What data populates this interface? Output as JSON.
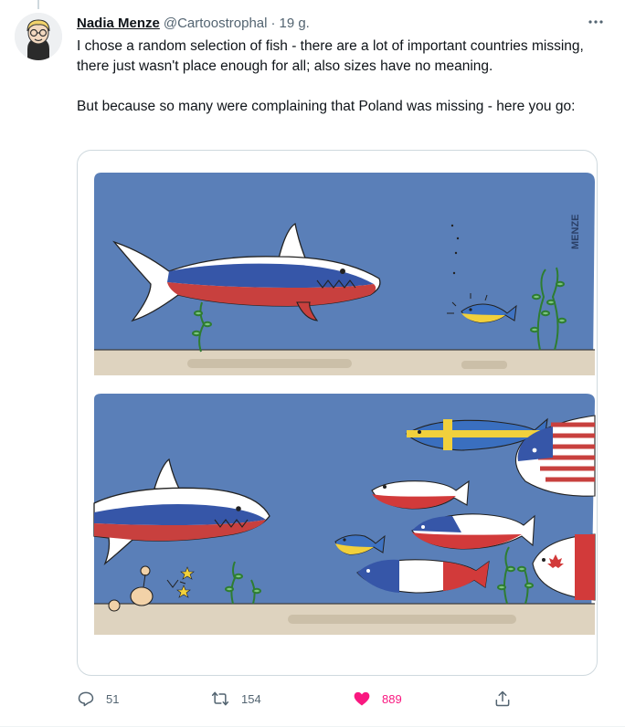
{
  "tweet": {
    "author_name": "Nadia Menze",
    "handle": "@Cartoostrophal",
    "separator": "·",
    "time": "19 g.",
    "paragraphs": [
      "I chose a random selection of fish - there are a lot of important countries missing, there just wasn't place enough for all; also sizes have no meaning.",
      "But because so many were complaining that Poland was missing - here you go:"
    ],
    "media": {
      "signature": "MENZE"
    },
    "actions": {
      "reply_count": "51",
      "retweet_count": "154",
      "like_count": "889"
    }
  },
  "colors": {
    "like_active": "#f91880",
    "secondary_text": "#536471",
    "sky": "#5a7fb8",
    "sand": "#ded3bf"
  },
  "icons": [
    "more-icon",
    "reply-icon",
    "retweet-icon",
    "like-icon",
    "share-icon"
  ]
}
